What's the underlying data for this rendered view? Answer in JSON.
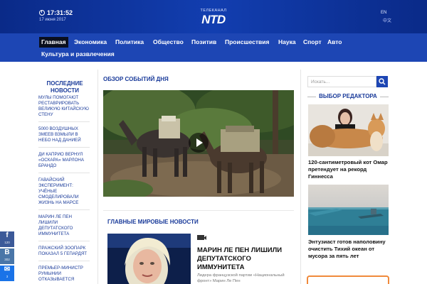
{
  "header": {
    "time": "17:31:52",
    "date": "17 июня 2017",
    "logo_small": "ТЕЛЕКАНАЛ",
    "logo_big": "NTD",
    "lang_primary": "EN",
    "lang_secondary": "中文"
  },
  "nav": {
    "items": [
      "Главная",
      "Экономика",
      "Политика",
      "Общество",
      "Позитив",
      "Происшествия",
      "Наука",
      "Спорт",
      "Авто",
      "Культура и развлечения"
    ],
    "active_index": 0
  },
  "latest": {
    "title": "ПОСЛЕДНИЕ НОВОСТИ",
    "items": [
      "Мулы помогают реставрировать Великую Китайскую стену",
      "5000 воздушных змеев взмыли в небо над Данией",
      "Ди Каприо вернул «Оскара» Марлона Брандо",
      "Гавайский эксперимент: учёные смоделировали жизнь на Марсе",
      "Марин Ле Пен лишили депутатского иммунитета",
      "Пражский зоопарк показал 5 гепардят",
      "Премьер-министр Румынии отказывается"
    ]
  },
  "social": [
    {
      "icon": "f",
      "count": "120",
      "color": "#3b5998"
    },
    {
      "icon": "B",
      "count": "302",
      "color": "#4a76a8"
    },
    {
      "icon": "✉",
      "count": "3",
      "color": "#1a73e8"
    }
  ],
  "center": {
    "day_title": "ОБЗОР СОБЫТИЙ ДНЯ",
    "world_title": "ГЛАВНЫЕ МИРОВЫЕ НОВОСТИ",
    "headline": "МАРИН ЛЕ ПЕН ЛИШИЛИ ДЕПУТАТСКОГО ИММУНИТЕТА",
    "lead": "Лидера французской партии «Национальный фронт» Марин Ле Пен"
  },
  "search": {
    "placeholder": "Искать..."
  },
  "editor": {
    "title": "ВЫБОР РЕДАКТОРА",
    "cat_caption": "120-сантиметровый кот Омар претендует на рекорд Гиннесса",
    "sea_caption": "Энтузиаст готов наполовину очистить Тихий океан от мусора за пять лет"
  },
  "colors": {
    "brand_blue": "#1d46b4",
    "header_dark": "#0a2a88",
    "accent_orange": "#f08a3c"
  }
}
